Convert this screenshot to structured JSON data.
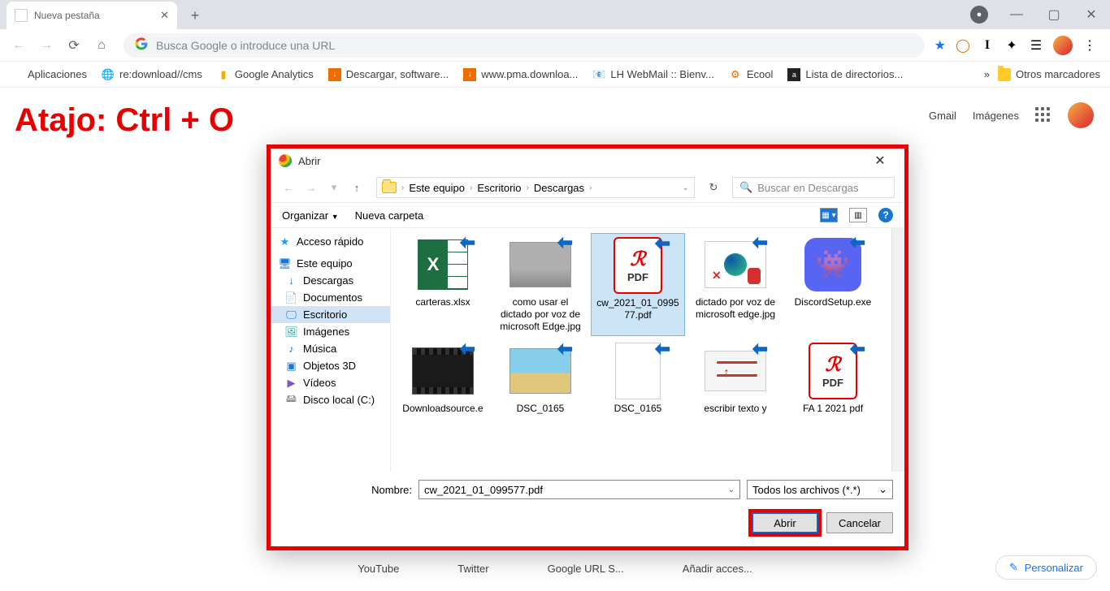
{
  "tab": {
    "title": "Nueva pestaña"
  },
  "omnibox": {
    "placeholder": "Busca Google o introduce una URL"
  },
  "bookmarks": {
    "apps": "Aplicaciones",
    "items": [
      "re:download//cms",
      "Google Analytics",
      "Descargar, software...",
      "www.pma.downloa...",
      "LH WebMail :: Bienv...",
      "Ecool",
      "Lista de directorios..."
    ],
    "more": "»",
    "other": "Otros marcadores"
  },
  "shortcut": "Atajo: Ctrl + O",
  "top_right": {
    "gmail": "Gmail",
    "images": "Imágenes"
  },
  "dialog": {
    "title": "Abrir",
    "crumbs": [
      "Este equipo",
      "Escritorio",
      "Descargas"
    ],
    "search_placeholder": "Buscar en Descargas",
    "organize": "Organizar",
    "new_folder": "Nueva carpeta",
    "sidebar": {
      "quick": "Acceso rápido",
      "pc": "Este equipo",
      "items": [
        "Descargas",
        "Documentos",
        "Escritorio",
        "Imágenes",
        "Música",
        "Objetos 3D",
        "Vídeos",
        "Disco local (C:)"
      ]
    },
    "files": [
      {
        "name": "carteras.xlsx"
      },
      {
        "name": "como usar el dictado por voz de microsoft Edge.jpg"
      },
      {
        "name": "cw_2021_01_099577.pdf"
      },
      {
        "name": "dictado por voz de microsoft edge.jpg"
      },
      {
        "name": "DiscordSetup.exe"
      },
      {
        "name": "Downloadsource.e"
      },
      {
        "name": "DSC_0165"
      },
      {
        "name": "DSC_0165"
      },
      {
        "name": "escribir texto y"
      },
      {
        "name": "FA 1 2021 pdf"
      }
    ],
    "name_label": "Nombre:",
    "name_value": "cw_2021_01_099577.pdf",
    "filter": "Todos los archivos (*.*)",
    "open": "Abrir",
    "cancel": "Cancelar"
  },
  "bottom_shortcuts": [
    "YouTube",
    "Twitter",
    "Google URL S...",
    "Añadir acces..."
  ],
  "personalize": "Personalizar"
}
